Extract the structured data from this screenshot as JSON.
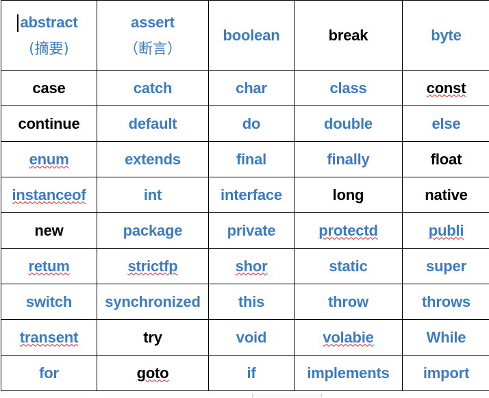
{
  "document": {
    "title": "Java keyword table",
    "caret_visible": true,
    "colors": {
      "keyword_blue": "#3b7cc0",
      "keyword_black": "#000000",
      "spellcheck_underline": "#e02020",
      "grid_line": "#000000",
      "background": "#ffffff"
    }
  },
  "table": {
    "columns": 5,
    "rows": [
      {
        "tall": true,
        "cells": [
          {
            "text": "abstract",
            "color": "blue",
            "misspelled": false,
            "gloss": "(摘要)",
            "caret": true
          },
          {
            "text": "assert",
            "color": "blue",
            "misspelled": false,
            "gloss": "（断言）",
            "caret": false
          },
          {
            "text": "boolean",
            "color": "blue",
            "misspelled": false,
            "gloss": "",
            "caret": false
          },
          {
            "text": "break",
            "color": "black",
            "misspelled": false,
            "gloss": "",
            "caret": false
          },
          {
            "text": "byte",
            "color": "blue",
            "misspelled": false,
            "gloss": "",
            "caret": false
          }
        ]
      },
      {
        "tall": false,
        "cells": [
          {
            "text": "case",
            "color": "black",
            "misspelled": false,
            "gloss": "",
            "caret": false
          },
          {
            "text": "catch",
            "color": "blue",
            "misspelled": false,
            "gloss": "",
            "caret": false
          },
          {
            "text": "char",
            "color": "blue",
            "misspelled": false,
            "gloss": "",
            "caret": false
          },
          {
            "text": "class",
            "color": "blue",
            "misspelled": false,
            "gloss": "",
            "caret": false
          },
          {
            "text": "const",
            "color": "black",
            "misspelled": true,
            "gloss": "",
            "caret": false
          }
        ]
      },
      {
        "tall": false,
        "cells": [
          {
            "text": "continue",
            "color": "black",
            "misspelled": false,
            "gloss": "",
            "caret": false
          },
          {
            "text": "default",
            "color": "blue",
            "misspelled": false,
            "gloss": "",
            "caret": false
          },
          {
            "text": "do",
            "color": "blue",
            "misspelled": false,
            "gloss": "",
            "caret": false
          },
          {
            "text": "double",
            "color": "blue",
            "misspelled": false,
            "gloss": "",
            "caret": false
          },
          {
            "text": "else",
            "color": "blue",
            "misspelled": false,
            "gloss": "",
            "caret": false
          }
        ]
      },
      {
        "tall": false,
        "cells": [
          {
            "text": "enum",
            "color": "blue",
            "misspelled": true,
            "gloss": "",
            "caret": false
          },
          {
            "text": "extends",
            "color": "blue",
            "misspelled": false,
            "gloss": "",
            "caret": false
          },
          {
            "text": "final",
            "color": "blue",
            "misspelled": false,
            "gloss": "",
            "caret": false
          },
          {
            "text": "finally",
            "color": "blue",
            "misspelled": false,
            "gloss": "",
            "caret": false
          },
          {
            "text": "float",
            "color": "black",
            "misspelled": false,
            "gloss": "",
            "caret": false
          }
        ]
      },
      {
        "tall": false,
        "cells": [
          {
            "text": "instanceof",
            "color": "blue",
            "misspelled": true,
            "gloss": "",
            "caret": false
          },
          {
            "text": "int",
            "color": "blue",
            "misspelled": false,
            "gloss": "",
            "caret": false
          },
          {
            "text": "interface",
            "color": "blue",
            "misspelled": false,
            "gloss": "",
            "caret": false
          },
          {
            "text": "long",
            "color": "black",
            "misspelled": false,
            "gloss": "",
            "caret": false
          },
          {
            "text": "native",
            "color": "black",
            "misspelled": false,
            "gloss": "",
            "caret": false
          }
        ]
      },
      {
        "tall": false,
        "cells": [
          {
            "text": "new",
            "color": "black",
            "misspelled": false,
            "gloss": "",
            "caret": false
          },
          {
            "text": "package",
            "color": "blue",
            "misspelled": false,
            "gloss": "",
            "caret": false
          },
          {
            "text": "private",
            "color": "blue",
            "misspelled": false,
            "gloss": "",
            "caret": false
          },
          {
            "text": "protectd",
            "color": "blue",
            "misspelled": true,
            "gloss": "",
            "caret": false
          },
          {
            "text": "publi",
            "color": "blue",
            "misspelled": true,
            "gloss": "",
            "caret": false
          }
        ]
      },
      {
        "tall": false,
        "cells": [
          {
            "text": "retum",
            "color": "blue",
            "misspelled": true,
            "gloss": "",
            "caret": false
          },
          {
            "text": "strictfp",
            "color": "blue",
            "misspelled": true,
            "gloss": "",
            "caret": false
          },
          {
            "text": "shor",
            "color": "blue",
            "misspelled": true,
            "gloss": "",
            "caret": false
          },
          {
            "text": "static",
            "color": "blue",
            "misspelled": false,
            "gloss": "",
            "caret": false
          },
          {
            "text": "super",
            "color": "blue",
            "misspelled": false,
            "gloss": "",
            "caret": false
          }
        ]
      },
      {
        "tall": false,
        "cells": [
          {
            "text": "switch",
            "color": "blue",
            "misspelled": false,
            "gloss": "",
            "caret": false
          },
          {
            "text": "synchronized",
            "color": "blue",
            "misspelled": false,
            "gloss": "",
            "caret": false
          },
          {
            "text": "this",
            "color": "blue",
            "misspelled": false,
            "gloss": "",
            "caret": false
          },
          {
            "text": "throw",
            "color": "blue",
            "misspelled": false,
            "gloss": "",
            "caret": false
          },
          {
            "text": "throws",
            "color": "blue",
            "misspelled": false,
            "gloss": "",
            "caret": false
          }
        ]
      },
      {
        "tall": false,
        "cells": [
          {
            "text": "transent",
            "color": "blue",
            "misspelled": true,
            "gloss": "",
            "caret": false
          },
          {
            "text": "try",
            "color": "black",
            "misspelled": false,
            "gloss": "",
            "caret": false
          },
          {
            "text": "void",
            "color": "blue",
            "misspelled": false,
            "gloss": "",
            "caret": false
          },
          {
            "text": "volabie",
            "color": "blue",
            "misspelled": true,
            "gloss": "",
            "caret": false
          },
          {
            "text": "While",
            "color": "blue",
            "misspelled": false,
            "gloss": "",
            "caret": false
          }
        ]
      },
      {
        "tall": false,
        "cells": [
          {
            "text": "for",
            "color": "blue",
            "misspelled": false,
            "gloss": "",
            "caret": false
          },
          {
            "text": "goto",
            "color": "black",
            "misspelled": true,
            "gloss": "",
            "caret": false
          },
          {
            "text": "if",
            "color": "blue",
            "misspelled": false,
            "gloss": "",
            "caret": false
          },
          {
            "text": "implements",
            "color": "blue",
            "misspelled": false,
            "gloss": "",
            "caret": false
          },
          {
            "text": "import",
            "color": "blue",
            "misspelled": false,
            "gloss": "",
            "caret": false
          }
        ]
      }
    ]
  }
}
